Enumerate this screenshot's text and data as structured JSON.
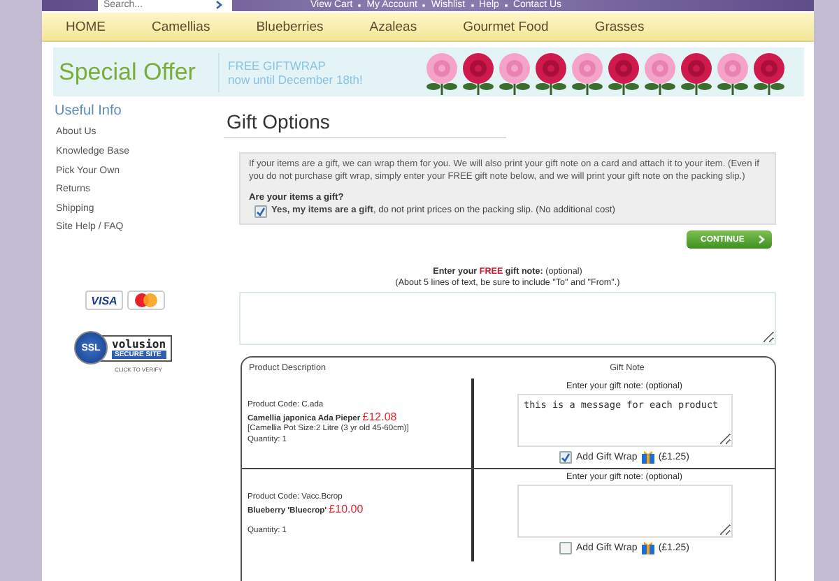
{
  "header": {
    "search": {
      "placeholder": "Search..."
    },
    "links": [
      "View Cart",
      "My Account",
      "Wishlist",
      "Help",
      "Contact Us"
    ]
  },
  "nav": {
    "items": [
      "HOME",
      "Camellias",
      "Blueberries",
      "Azaleas",
      "Gourmet Food",
      "Grasses"
    ]
  },
  "banner": {
    "title": "Special Offer",
    "lines": [
      "FREE GIFTWRAP",
      "now until December 18th!"
    ]
  },
  "sidebar": {
    "heading": "Useful Info",
    "items": [
      "About Us",
      "Knowledge Base",
      "Pick Your Own",
      "Returns",
      "Shipping",
      "Site Help / FAQ"
    ],
    "card_label": "VISA",
    "ssl": {
      "seal": "SSL",
      "brand": "volusion",
      "tagline": "SECURE SITE",
      "caption": "CLICK TO VERIFY"
    }
  },
  "page_title": "Gift Options",
  "intro": {
    "text": "If your items are a gift, we can wrap them for you. We will also print your gift note on a card and attach it to your item. (Even if you do not purchase gift wrap, simply enter your FREE gift note below, and we will print your gift note on the packing slip.)",
    "question": "Are your items a gift?",
    "checkbox": {
      "label": "**Yes, my items are a gift**, do not print prices on the packing slip. (No additional cost)",
      "checked": true
    }
  },
  "continue_button": "CONTINUE",
  "gift_note": {
    "prompt": [
      {
        "text": "Enter your",
        "kind": "bold"
      },
      {
        "text": "FREE",
        "kind": "highlight"
      },
      {
        "text": "gift note:",
        "kind": "bold"
      },
      {
        "text": "(optional)",
        "kind": "plain"
      }
    ],
    "hint": "(About 5 lines of text, be sure to include \"To\" and \"From\".)"
  },
  "table": {
    "columns": [
      "Product Description",
      "Gift Note"
    ],
    "rows": [
      {
        "code": "Product Code: C.ada",
        "name": "Camellia japonica Ada Pieper",
        "price": "£12.08",
        "option": "[Camellia Pot Size:2 Litre (3 yr old 45-60cm)]",
        "quantity": "Quantity: 1",
        "note_label": "Enter your gift note: (optional)",
        "note_value": "this is a message for each product",
        "wrap": {
          "label": "Add Gift Wrap",
          "price": "(£1.25)",
          "checked": true
        }
      },
      {
        "code": "Product Code: Vacc.Bcrop",
        "name": "Blueberry 'Bluecrop'",
        "price": "£10.00",
        "quantity": "Quantity: 1",
        "note_label": "Enter your gift note: (optional)",
        "wrap": {
          "label": "Add Gift Wrap",
          "price": "(£1.25)",
          "checked": false
        }
      }
    ]
  }
}
